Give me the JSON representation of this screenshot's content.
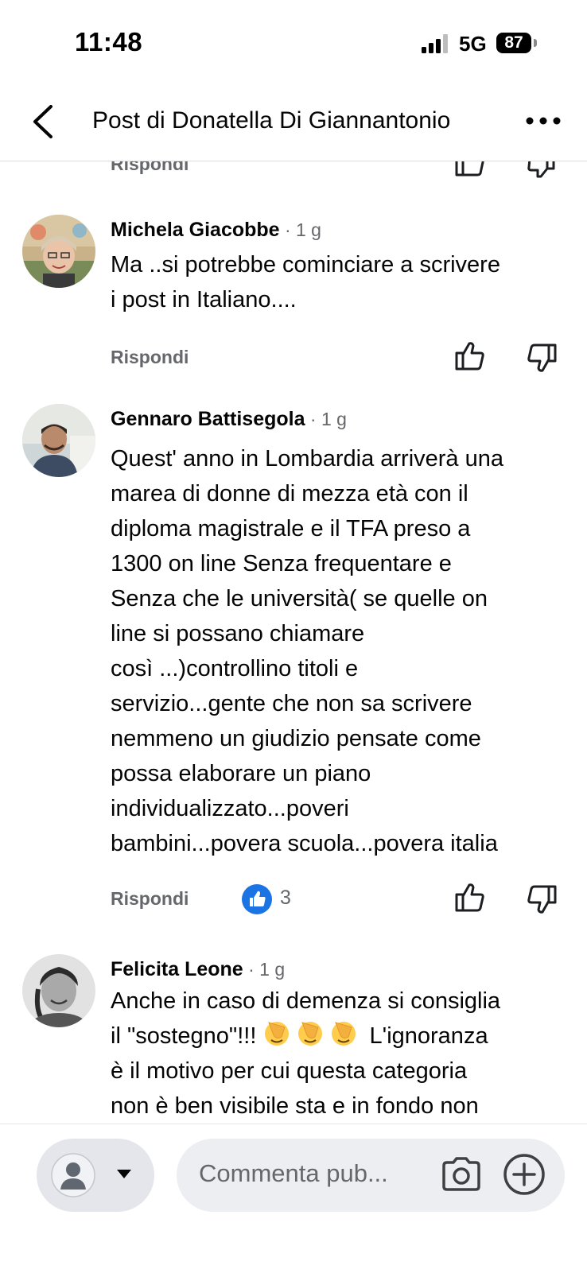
{
  "status_bar": {
    "time": "11:48",
    "network": "5G",
    "battery": "87"
  },
  "header": {
    "title": "Post di Donatella Di Giannantonio",
    "back_icon": "chevron-left-icon",
    "more_icon": "more-horizontal-icon"
  },
  "partial_previous": {
    "reply_label": "Rispondi"
  },
  "comments": [
    {
      "author": "Michela Giacobbe",
      "time": " · 1 g",
      "text_lines": [
        "Ma ..si potrebbe cominciare a scrivere",
        "i post in Italiano...."
      ],
      "reply_label": "Rispondi"
    },
    {
      "author": "Gennaro Battisegola",
      "time": " · 1 g",
      "text_lines": [
        "Quest' anno in Lombardia arriverà una",
        "marea di donne di mezza età con il",
        "diploma magistrale e il TFA preso a",
        "1300 on line Senza frequentare e",
        "Senza che le università( se quelle on",
        "line si possano chiamare",
        "così ...)controllino titoli e",
        "servizio...gente che non sa scrivere",
        "nemmeno un giudizio pensate come",
        "possa elaborare un piano",
        "individualizzato...poveri",
        "bambini...povera scuola...povera italia"
      ],
      "reply_label": "Rispondi",
      "reaction": {
        "icon": "like-reaction-icon",
        "count": "3",
        "color": "#1b74e4"
      }
    },
    {
      "author": "Felicita Leone",
      "time": " · 1 g",
      "text_line1": "Anche in caso di demenza si consiglia",
      "text_line2_before": "il \"sostegno\"!!!",
      "text_line2_after": "L'ignoranza",
      "text_line2_emoji": "face-palm-emoji",
      "text_line3": "è il motivo per cui questa categoria",
      "text_line4": "non è ben visibile sta e in fondo non"
    }
  ],
  "composer": {
    "placeholder": "Commenta pub...",
    "identity_icon": "avatar-placeholder-icon",
    "camera_icon": "camera-icon",
    "add_icon": "plus-circle-icon"
  }
}
